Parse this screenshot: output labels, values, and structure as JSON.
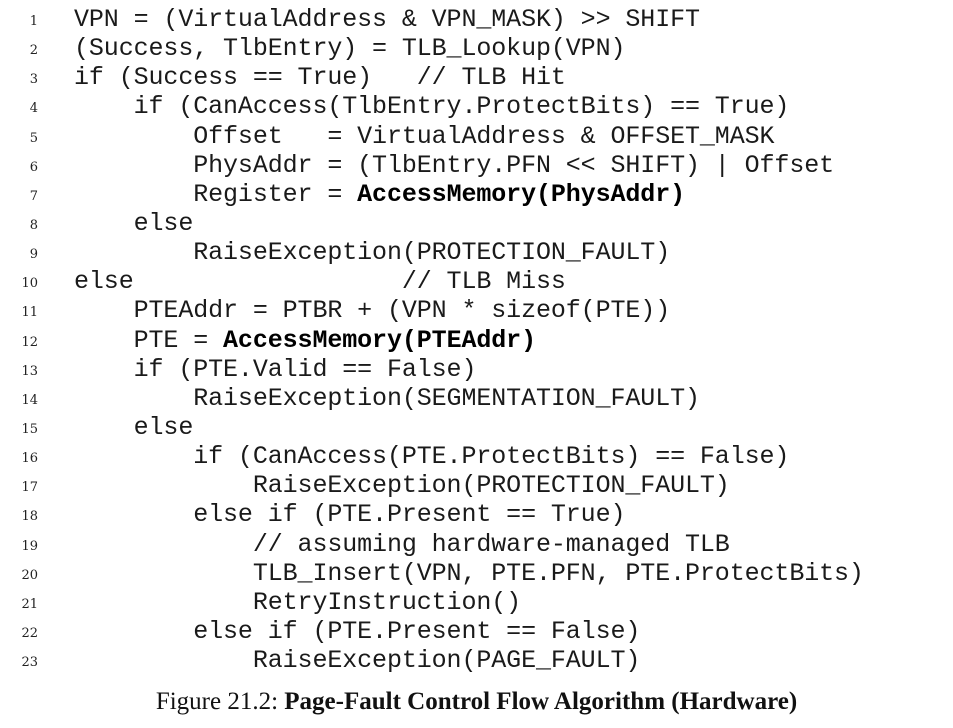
{
  "listing": {
    "lines": [
      {
        "number": "1",
        "segments": [
          {
            "text": "VPN = (VirtualAddress & VPN_MASK) >> SHIFT",
            "bold": false
          }
        ]
      },
      {
        "number": "2",
        "segments": [
          {
            "text": "(Success, TlbEntry) = TLB_Lookup(VPN)",
            "bold": false
          }
        ]
      },
      {
        "number": "3",
        "segments": [
          {
            "text": "if (Success == True)   // TLB Hit",
            "bold": false
          }
        ]
      },
      {
        "number": "4",
        "segments": [
          {
            "text": "    if (CanAccess(TlbEntry.ProtectBits) == True)",
            "bold": false
          }
        ]
      },
      {
        "number": "5",
        "segments": [
          {
            "text": "        Offset   = VirtualAddress & OFFSET_MASK",
            "bold": false
          }
        ]
      },
      {
        "number": "6",
        "segments": [
          {
            "text": "        PhysAddr = (TlbEntry.PFN << SHIFT) | Offset",
            "bold": false
          }
        ]
      },
      {
        "number": "7",
        "segments": [
          {
            "text": "        Register = ",
            "bold": false
          },
          {
            "text": "AccessMemory(PhysAddr)",
            "bold": true
          }
        ]
      },
      {
        "number": "8",
        "segments": [
          {
            "text": "    else",
            "bold": false
          }
        ]
      },
      {
        "number": "9",
        "segments": [
          {
            "text": "        RaiseException(PROTECTION_FAULT)",
            "bold": false
          }
        ]
      },
      {
        "number": "10",
        "segments": [
          {
            "text": "else                  // TLB Miss",
            "bold": false
          }
        ]
      },
      {
        "number": "11",
        "segments": [
          {
            "text": "    PTEAddr = PTBR + (VPN * sizeof(PTE))",
            "bold": false
          }
        ]
      },
      {
        "number": "12",
        "segments": [
          {
            "text": "    PTE = ",
            "bold": false
          },
          {
            "text": "AccessMemory(PTEAddr)",
            "bold": true
          }
        ]
      },
      {
        "number": "13",
        "segments": [
          {
            "text": "    if (PTE.Valid == False)",
            "bold": false
          }
        ]
      },
      {
        "number": "14",
        "segments": [
          {
            "text": "        RaiseException(SEGMENTATION_FAULT)",
            "bold": false
          }
        ]
      },
      {
        "number": "15",
        "segments": [
          {
            "text": "    else",
            "bold": false
          }
        ]
      },
      {
        "number": "16",
        "segments": [
          {
            "text": "        if (CanAccess(PTE.ProtectBits) == False)",
            "bold": false
          }
        ]
      },
      {
        "number": "17",
        "segments": [
          {
            "text": "            RaiseException(PROTECTION_FAULT)",
            "bold": false
          }
        ]
      },
      {
        "number": "18",
        "segments": [
          {
            "text": "        else if (PTE.Present == True)",
            "bold": false
          }
        ]
      },
      {
        "number": "19",
        "segments": [
          {
            "text": "            // assuming hardware-managed TLB",
            "bold": false
          }
        ]
      },
      {
        "number": "20",
        "segments": [
          {
            "text": "            TLB_Insert(VPN, PTE.PFN, PTE.ProtectBits)",
            "bold": false
          }
        ]
      },
      {
        "number": "21",
        "segments": [
          {
            "text": "            RetryInstruction()",
            "bold": false
          }
        ]
      },
      {
        "number": "22",
        "segments": [
          {
            "text": "        else if (PTE.Present == False)",
            "bold": false
          }
        ]
      },
      {
        "number": "23",
        "segments": [
          {
            "text": "            RaiseException(PAGE_FAULT)",
            "bold": false
          }
        ]
      }
    ]
  },
  "caption": {
    "label": "Figure 21.2: ",
    "title": "Page-Fault Control Flow Algorithm (Hardware)"
  }
}
